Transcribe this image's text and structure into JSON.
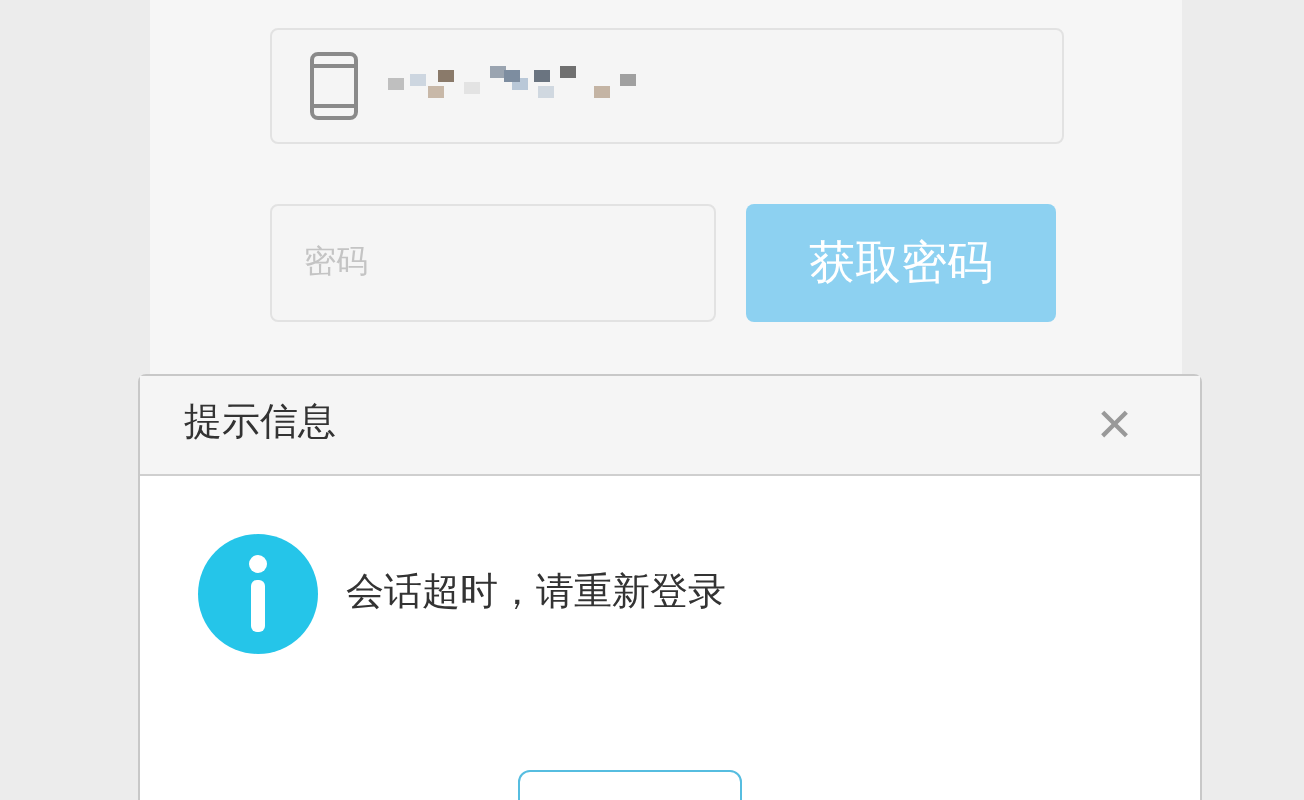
{
  "login_form": {
    "phone_field": {
      "kind": "masked"
    },
    "password_field": {
      "placeholder": "密码"
    },
    "get_password_button": {
      "label": "获取密码"
    }
  },
  "dialog": {
    "title": "提示信息",
    "close": "×",
    "message": "会话超时，请重新登录",
    "button": {
      "kind": "outline"
    }
  }
}
